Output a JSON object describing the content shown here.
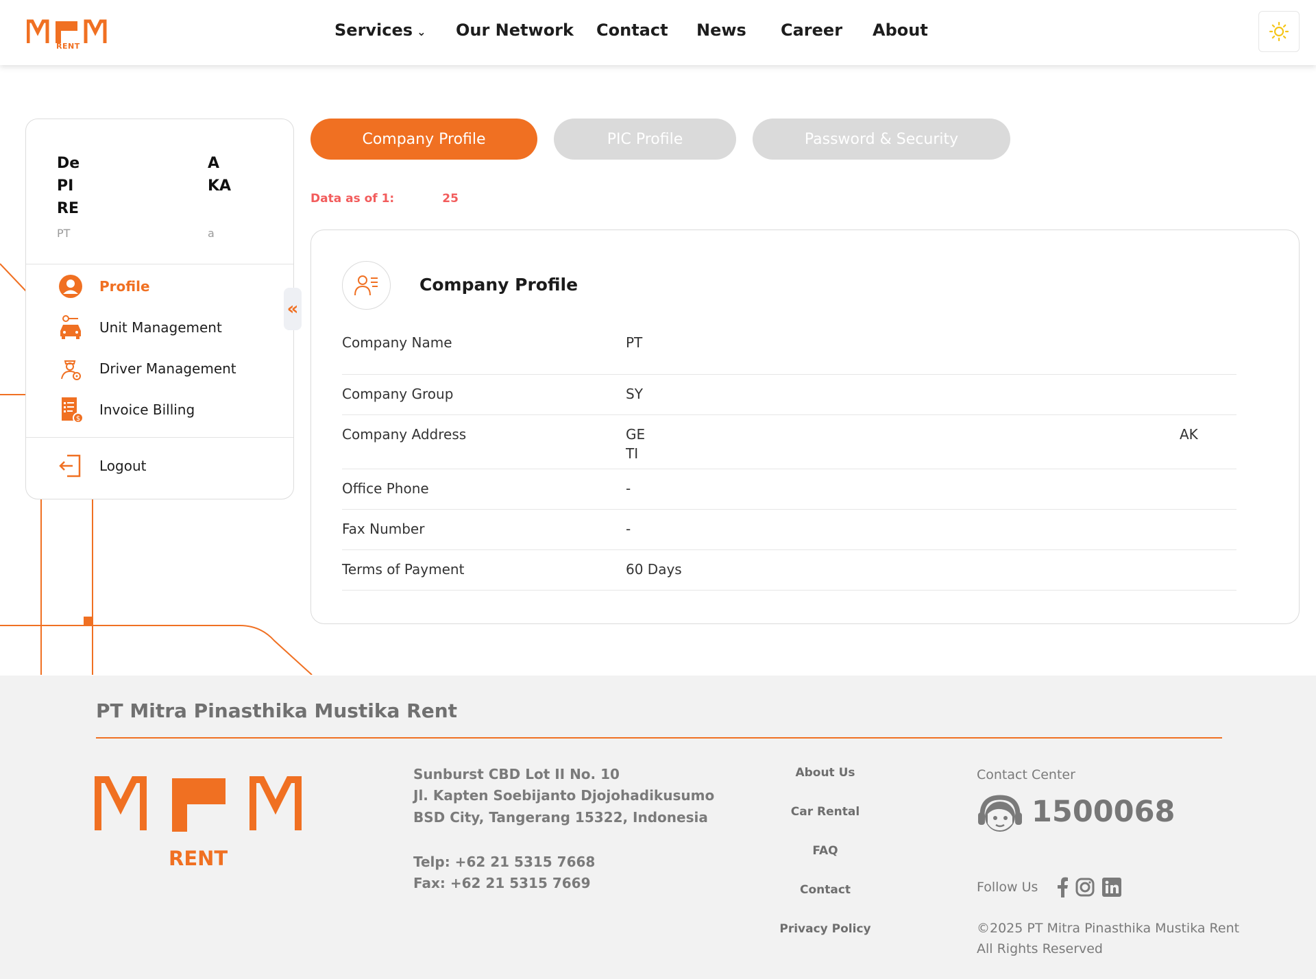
{
  "header": {
    "logo_sub": "RENT",
    "nav": [
      {
        "label": "Services",
        "has_dropdown": true
      },
      {
        "label": "Our Network"
      },
      {
        "label": "Contact"
      },
      {
        "label": "News"
      },
      {
        "label": "Career"
      },
      {
        "label": "About"
      }
    ],
    "theme_icon": "sun-icon"
  },
  "sidebar": {
    "user_lines": [
      {
        "left": "De",
        "right": "A"
      },
      {
        "left": "PI",
        "right": "KA"
      },
      {
        "left": "RE",
        "right": ""
      }
    ],
    "user_sub": {
      "left": "PT",
      "right": "a"
    },
    "menu": [
      {
        "label": "Profile",
        "icon": "user-circle-icon",
        "active": true
      },
      {
        "label": "Unit Management",
        "icon": "car-icon"
      },
      {
        "label": "Driver Management",
        "icon": "driver-icon"
      },
      {
        "label": "Invoice Billing",
        "icon": "invoice-icon"
      }
    ],
    "logout": {
      "label": "Logout",
      "icon": "logout-icon"
    },
    "collapse_symbol": "«"
  },
  "tabs": [
    {
      "label": "Company Profile",
      "active": true
    },
    {
      "label": "PIC Profile",
      "active": false
    },
    {
      "label": "Password & Security",
      "active": false
    }
  ],
  "data_as_of": {
    "left": "Data as of 1:",
    "right": "25"
  },
  "profile": {
    "title": "Company Profile",
    "rows": [
      {
        "key": "Company Name",
        "value": "PT"
      },
      {
        "key": "Company Group",
        "value": "SY"
      },
      {
        "key": "Company Address",
        "value": "GE",
        "value_end": "AK",
        "value_line2": "TI"
      },
      {
        "key": "Office Phone",
        "value": "-"
      },
      {
        "key": "Fax Number",
        "value": "-"
      },
      {
        "key": "Terms of Payment",
        "value": "60 Days"
      }
    ]
  },
  "footer": {
    "company": "PT Mitra Pinasthika Mustika Rent",
    "logo_sub": "RENT",
    "address": [
      "Sunburst CBD Lot II No. 10",
      "Jl. Kapten Soebijanto Djojohadikusumo",
      "BSD City, Tangerang 15322, Indonesia"
    ],
    "telp": "Telp: +62 21 5315 7668",
    "fax": "Fax: +62 21 5315 7669",
    "links": [
      "About Us",
      "Car Rental",
      "FAQ",
      "Contact",
      "Privacy Policy"
    ],
    "contact_center_label": "Contact Center",
    "contact_center_number": "1500068",
    "follow_label": "Follow Us",
    "social": [
      "facebook-icon",
      "instagram-icon",
      "linkedin-icon"
    ],
    "copyright": "©2025 PT Mitra Pinasthika Mustika Rent",
    "rights": "All Rights Reserved"
  },
  "colors": {
    "accent": "#f07022",
    "inactive_tab": "#dadada",
    "data_as_of": "#f25c5c",
    "footer_bg": "#f2f2f2"
  }
}
